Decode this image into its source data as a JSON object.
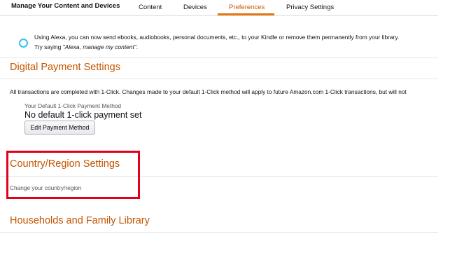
{
  "header": {
    "title": "Manage Your Content and Devices",
    "tabs": [
      {
        "label": "Content",
        "active": false
      },
      {
        "label": "Devices",
        "active": false
      },
      {
        "label": "Preferences",
        "active": true
      },
      {
        "label": "Privacy Settings",
        "active": false
      }
    ]
  },
  "alexa": {
    "icon": "alexa-ring-icon",
    "line1": "Using Alexa, you can now send ebooks, audiobooks, personal documents, etc., to your Kindle or remove them permanently from your library.",
    "line2_prefix": "Try saying ",
    "line2_quote": "\"Alexa, manage my content\"",
    "line2_suffix": "."
  },
  "payment": {
    "title": "Digital Payment Settings",
    "note": "All transactions are completed with 1-Click. Changes made to your default 1-Click method will apply to future Amazon.com 1-Click transactions, but will not",
    "default_label": "Your Default 1-Click Payment Method",
    "default_value": "No default 1-click payment set",
    "edit_button": "Edit Payment Method"
  },
  "country": {
    "title": "Country/Region Settings",
    "link": "Change your country/region"
  },
  "households": {
    "title": "Households and Family Library"
  },
  "colors": {
    "accent": "#c45500",
    "tab_underline": "#e47911",
    "alexa_ring": "#31c4f3",
    "highlight_box": "#e4001b"
  }
}
